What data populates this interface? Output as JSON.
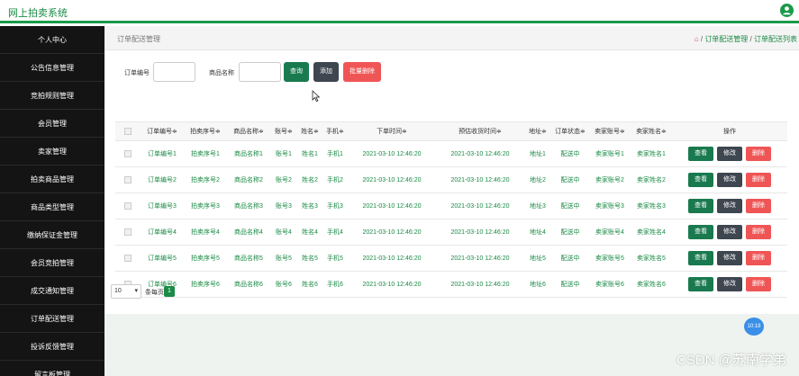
{
  "header": {
    "site_title": "网上拍卖系统"
  },
  "sidebar": {
    "items": [
      "个人中心",
      "公告信息管理",
      "竞拍规则管理",
      "会员管理",
      "卖家管理",
      "拍卖商品管理",
      "商品类型管理",
      "缴纳保证金管理",
      "会员竞拍管理",
      "成交通知管理",
      "订单配送管理",
      "投诉反馈管理",
      "留言板管理"
    ]
  },
  "breadcrumb": {
    "page_heading": "订单配送管理",
    "link1": "订单配送管理",
    "link2": "订单配送列表"
  },
  "search": {
    "order_no_label": "订单编号",
    "order_no_value": "",
    "product_name_label": "商品名称",
    "product_name_value": "",
    "query_label": "查询",
    "add_label": "添加",
    "batch_delete_label": "批量删除"
  },
  "table": {
    "headers": [
      "订单编号≑",
      "拍卖序号≑",
      "商品名称≑",
      "账号≑",
      "姓名≑",
      "手机≑",
      "下单时间≑",
      "预估收货时间≑",
      "地址≑",
      "订单状态≑",
      "卖家账号≑",
      "卖家姓名≑",
      "操作"
    ],
    "rows": [
      [
        "订单编号1",
        "拍卖序号1",
        "商品名称1",
        "账号1",
        "姓名1",
        "手机1",
        "2021-03-10 12:46:20",
        "2021-03-10 12:46:20",
        "地址1",
        "配送中",
        "卖家账号1",
        "卖家姓名1"
      ],
      [
        "订单编号2",
        "拍卖序号2",
        "商品名称2",
        "账号2",
        "姓名2",
        "手机2",
        "2021-03-10 12:46:20",
        "2021-03-10 12:46:20",
        "地址2",
        "配送中",
        "卖家账号2",
        "卖家姓名2"
      ],
      [
        "订单编号3",
        "拍卖序号3",
        "商品名称3",
        "账号3",
        "姓名3",
        "手机3",
        "2021-03-10 12:46:20",
        "2021-03-10 12:46:20",
        "地址3",
        "配送中",
        "卖家账号3",
        "卖家姓名3"
      ],
      [
        "订单编号4",
        "拍卖序号4",
        "商品名称4",
        "账号4",
        "姓名4",
        "手机4",
        "2021-03-10 12:46:20",
        "2021-03-10 12:46:20",
        "地址4",
        "配送中",
        "卖家账号4",
        "卖家姓名4"
      ],
      [
        "订单编号5",
        "拍卖序号5",
        "商品名称5",
        "账号5",
        "姓名5",
        "手机5",
        "2021-03-10 12:46:20",
        "2021-03-10 12:46:20",
        "地址5",
        "配送中",
        "卖家账号5",
        "卖家姓名5"
      ],
      [
        "订单编号6",
        "拍卖序号6",
        "商品名称6",
        "账号6",
        "姓名6",
        "手机6",
        "2021-03-10 12:46:20",
        "2021-03-10 12:46:20",
        "地址6",
        "配送中",
        "卖家账号6",
        "卖家姓名6"
      ]
    ],
    "actions": {
      "view": "查看",
      "edit": "修改",
      "delete": "删除"
    }
  },
  "pagination": {
    "page_size": "10",
    "per_page_label": "条每页",
    "current_page": "1"
  },
  "floating_badge": "10:18",
  "watermark": "CSDN @苏南学弟",
  "colors": {
    "accent": "#1a8a45",
    "sidebar": "#141414",
    "query": "#1a7a4f",
    "add": "#3e4650",
    "delete": "#f05555"
  }
}
